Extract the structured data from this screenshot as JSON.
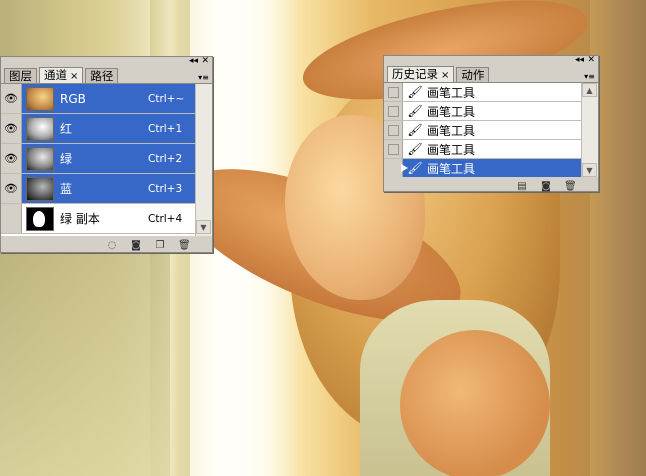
{
  "colors": {
    "selected_row": "#3868c7",
    "panel_bg": "#d4d0c8",
    "list_bg": "#ffffff"
  },
  "channels_panel": {
    "tabs": [
      {
        "label": "图层",
        "active": false
      },
      {
        "label": "通道",
        "active": true,
        "close": "×"
      },
      {
        "label": "路径",
        "active": false
      }
    ],
    "menu_glyph": "▾≡",
    "rows": [
      {
        "name": "RGB",
        "shortcut": "Ctrl+~",
        "visible": true,
        "selected": true,
        "icon": "eye-icon"
      },
      {
        "name": "红",
        "shortcut": "Ctrl+1",
        "visible": true,
        "selected": true,
        "icon": "eye-icon"
      },
      {
        "name": "绿",
        "shortcut": "Ctrl+2",
        "visible": true,
        "selected": true,
        "icon": "eye-icon"
      },
      {
        "name": "蓝",
        "shortcut": "Ctrl+3",
        "visible": true,
        "selected": true,
        "icon": "eye-icon"
      },
      {
        "name": "绿 副本",
        "shortcut": "Ctrl+4",
        "visible": false,
        "selected": false
      }
    ],
    "footer_icons": [
      "load-selection-icon",
      "save-selection-icon",
      "new-channel-icon",
      "trash-icon"
    ]
  },
  "history_panel": {
    "tabs": [
      {
        "label": "历史记录",
        "active": true,
        "close": "×"
      },
      {
        "label": "动作",
        "active": false
      }
    ],
    "menu_glyph": "▾≡",
    "rows": [
      {
        "label": "画笔工具",
        "selected": false
      },
      {
        "label": "画笔工具",
        "selected": false
      },
      {
        "label": "画笔工具",
        "selected": false
      },
      {
        "label": "画笔工具",
        "selected": false
      },
      {
        "label": "画笔工具",
        "selected": true
      }
    ],
    "footer_icons": [
      "new-document-from-state-icon",
      "snapshot-icon",
      "trash-icon"
    ]
  }
}
